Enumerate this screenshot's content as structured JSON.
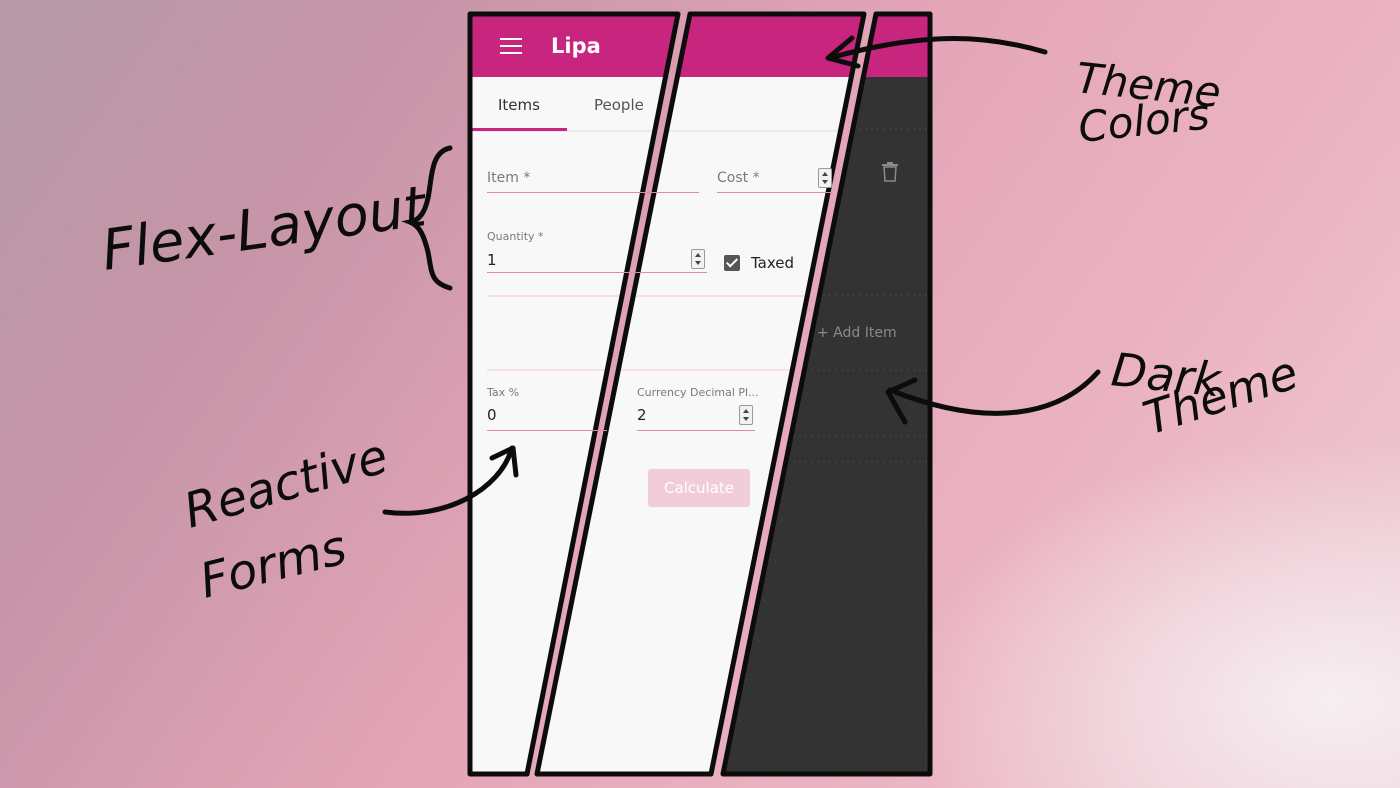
{
  "app": {
    "title": "Lipa",
    "tabs": [
      {
        "label": "Items",
        "active": true
      },
      {
        "label": "People",
        "active": false
      }
    ]
  },
  "form": {
    "item_label": "Item *",
    "cost_label": "Cost *",
    "quantity_label": "Quantity *",
    "quantity_value": "1",
    "taxed_label": "Taxed",
    "taxed_checked": true,
    "tax_label": "Tax %",
    "tax_value": "0",
    "currency_label": "Currency Decimal Pl...",
    "currency_value": "2",
    "calculate_label": "Calculate"
  },
  "dark_panel": {
    "add_item_label": "+ Add Item",
    "delete_icon": "trash-icon"
  },
  "annotations": {
    "flex_layout": "Flex-Layout",
    "theme_colors_line1": "Theme",
    "theme_colors_line2": "Colors",
    "dark_theme_line1": "Dark",
    "dark_theme_line2": "Theme",
    "reactive_forms_line1": "Reactive",
    "reactive_forms_line2": "Forms"
  },
  "colors": {
    "primary": "#c8257e",
    "light_background": "#f8f8f8",
    "dark_background": "#333333",
    "accent_underline": "#e08aa8"
  }
}
